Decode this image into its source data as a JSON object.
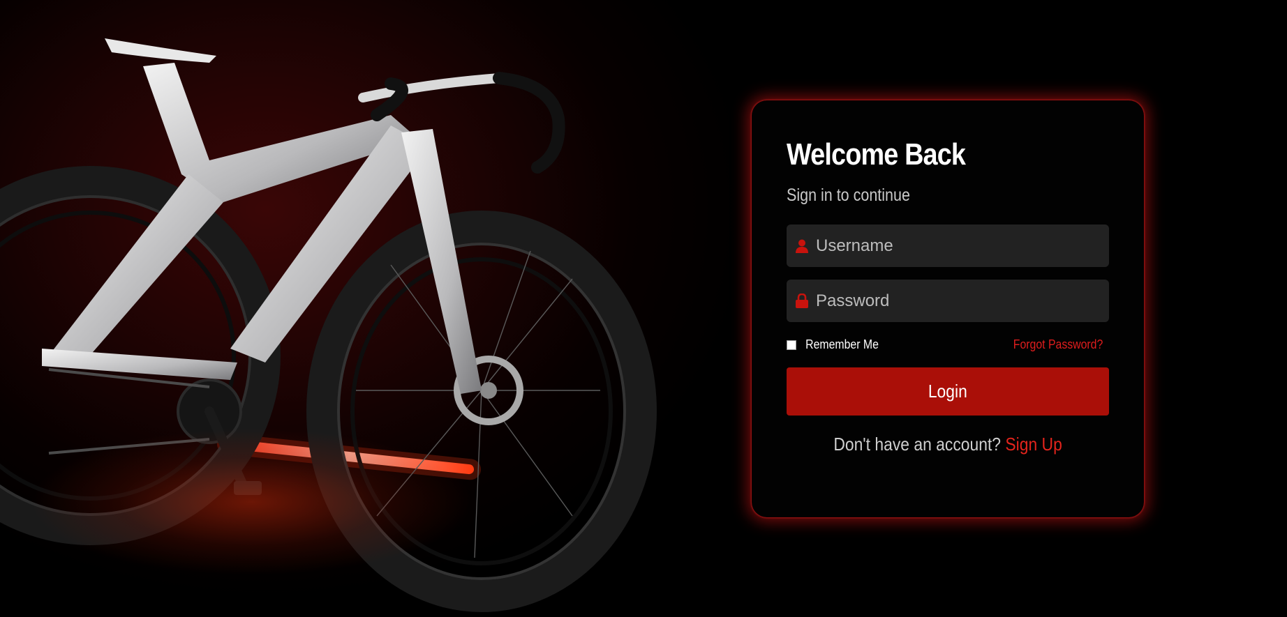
{
  "login": {
    "title": "Welcome Back",
    "subtitle": "Sign in to continue",
    "username_placeholder": "Username",
    "password_placeholder": "Password",
    "remember_label": "Remember Me",
    "forgot_label": "Forgot Password?",
    "login_label": "Login",
    "signup_prompt": "Don't have an account?",
    "signup_label": "Sign Up"
  },
  "icons": {
    "username": "user-icon",
    "password": "lock-icon"
  },
  "colors": {
    "accent": "#aa0f08",
    "link": "#e3241c",
    "card_glow": "#d21414",
    "field_bg": "#222222"
  }
}
